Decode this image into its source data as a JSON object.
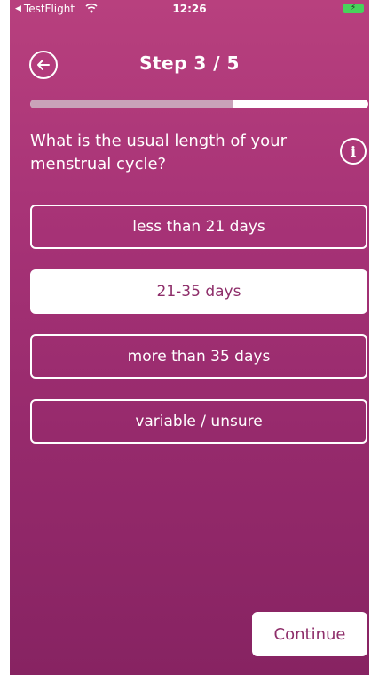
{
  "status_bar": {
    "back_app": "TestFlight",
    "time": "12:26",
    "battery_color": "#48d35b"
  },
  "header": {
    "title": "Step 3 / 5",
    "progress_fraction": 0.6
  },
  "question": {
    "text": "What is the usual length of your menstrual cycle?",
    "info_icon": "i"
  },
  "options": [
    {
      "label": "less than 21 days",
      "selected": false
    },
    {
      "label": "21-35 days",
      "selected": true
    },
    {
      "label": "more than 35 days",
      "selected": false
    },
    {
      "label": "variable / unsure",
      "selected": false
    }
  ],
  "footer": {
    "continue_label": "Continue"
  },
  "colors": {
    "background_top": "#b8407e",
    "background_bottom": "#872362",
    "accent_text": "#8e2e6a",
    "progress_fill": "#c9a2b9"
  }
}
